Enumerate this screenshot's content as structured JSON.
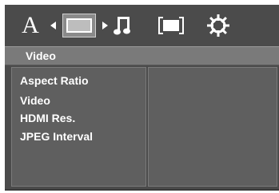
{
  "toolbar": {
    "language_glyph": "A",
    "items": [
      {
        "name": "language-icon"
      },
      {
        "name": "display-icon",
        "selected": true
      },
      {
        "name": "audio-icon"
      },
      {
        "name": "screen-ratio-icon"
      },
      {
        "name": "settings-gear-icon"
      }
    ]
  },
  "section": {
    "title": "Video"
  },
  "menu": {
    "items": [
      {
        "label": "Aspect Ratio"
      },
      {
        "label": "Video"
      },
      {
        "label": "HDMI Res."
      },
      {
        "label": "JPEG Interval"
      }
    ]
  },
  "colors": {
    "panel": "#5f5f5f",
    "topbar": "#4b4b4b",
    "strip": "#7a7a7a",
    "text": "#ffffff"
  }
}
